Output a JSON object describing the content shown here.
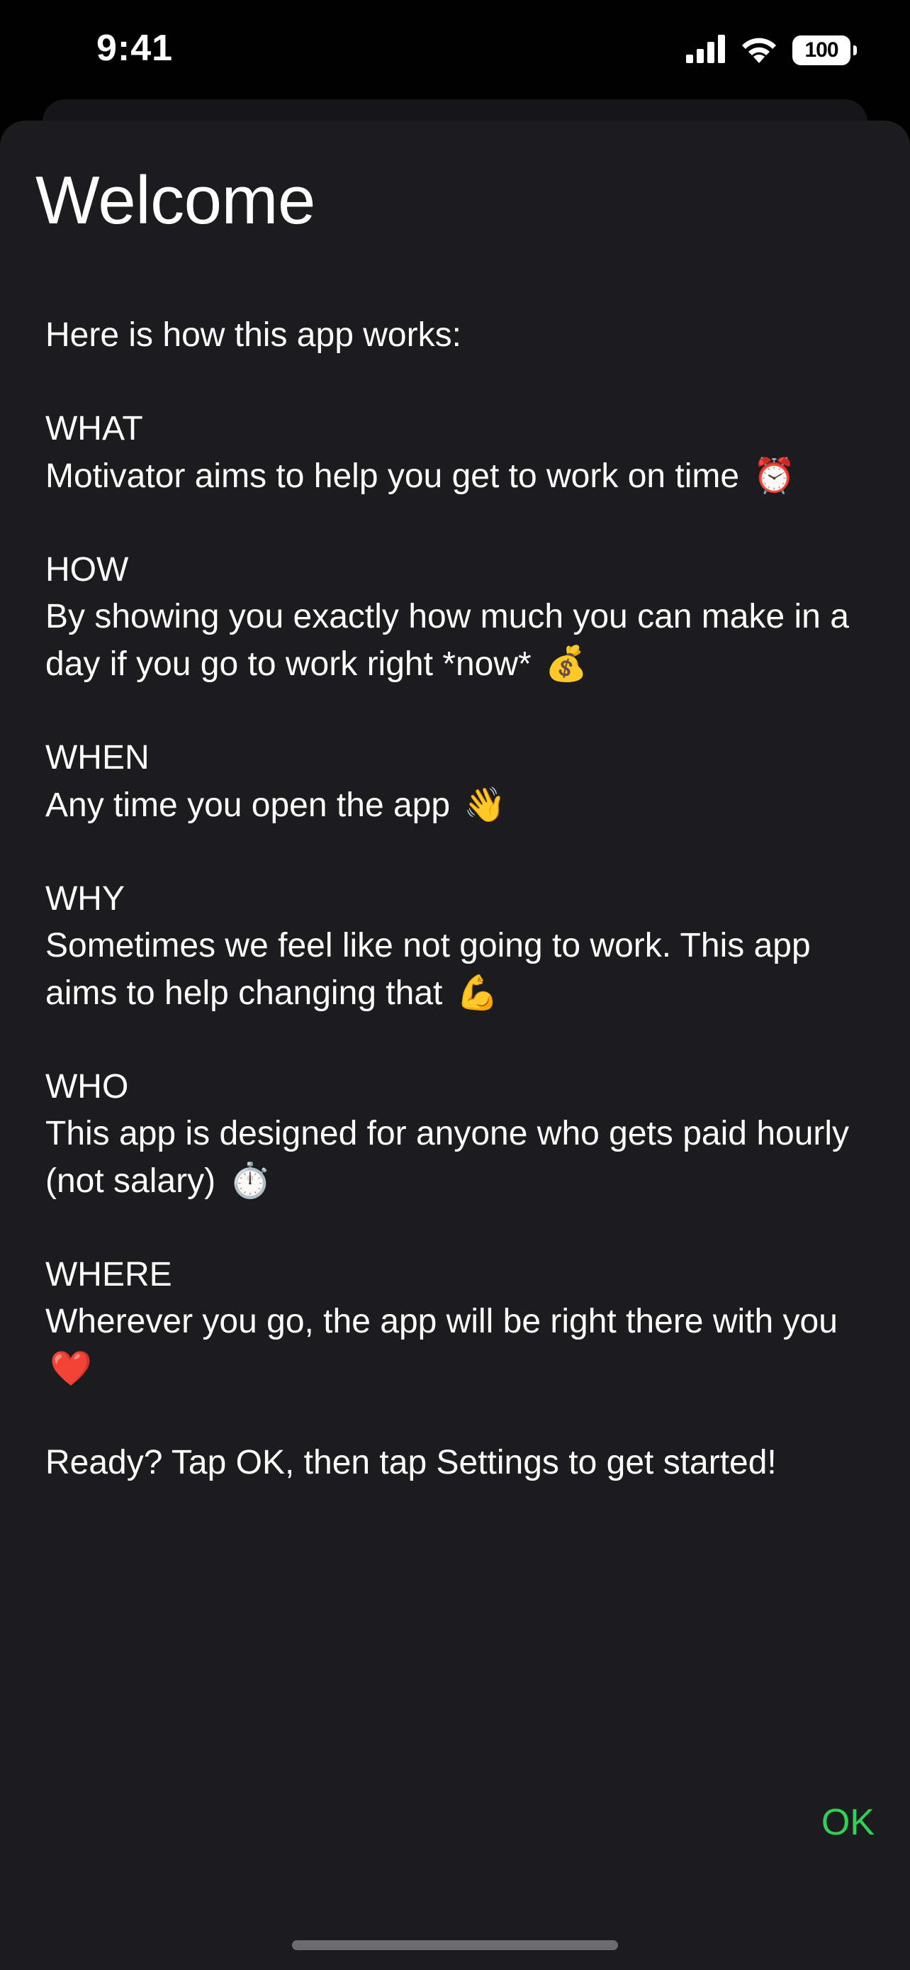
{
  "status_bar": {
    "time": "9:41",
    "battery": "100"
  },
  "sheet": {
    "title": "Welcome",
    "intro": "Here is how this app works:",
    "sections": [
      {
        "heading": "WHAT",
        "body": "Motivator aims to help you get to work on time",
        "emoji": "⏰"
      },
      {
        "heading": "HOW",
        "body": "By showing you exactly how much you can make in a day if you go to work right *now*",
        "emoji": "💰"
      },
      {
        "heading": "WHEN",
        "body": "Any time you open the app",
        "emoji": "👋"
      },
      {
        "heading": "WHY",
        "body": "Sometimes we feel like not going to work. This app aims to help changing that",
        "emoji": "💪"
      },
      {
        "heading": "WHO",
        "body": "This app is designed for anyone who gets paid hourly (not salary)",
        "emoji": "⏱️"
      },
      {
        "heading": "WHERE",
        "body": "Wherever you go, the app will be right there with you",
        "emoji": "❤️"
      }
    ],
    "closing": "Ready? Tap OK, then tap Settings to get started!",
    "ok_label": "OK"
  },
  "colors": {
    "background": "#000000",
    "sheet": "#1c1c1e",
    "accent": "#30d158"
  },
  "icons": [
    "cellular-signal-icon",
    "wifi-icon",
    "battery-icon"
  ]
}
